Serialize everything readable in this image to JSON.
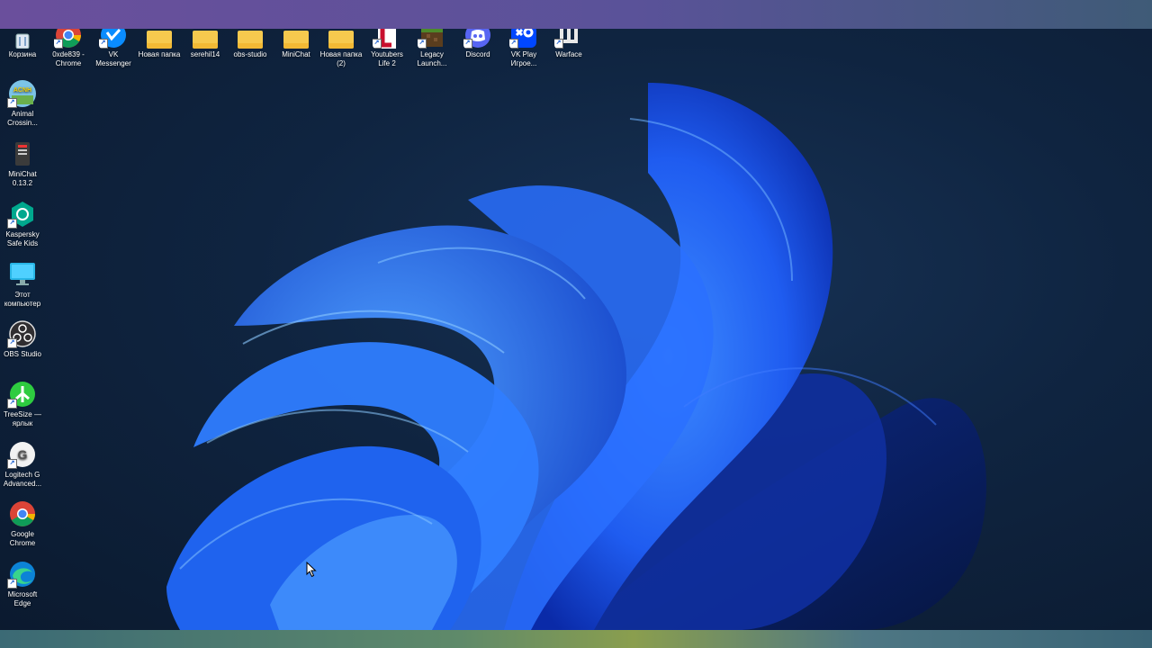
{
  "desktop": {
    "top_icons": [
      {
        "label": "Корзина",
        "icon": "recycle-bin-icon",
        "shortcut": false
      },
      {
        "label": "0xde839 -\nChrome",
        "icon": "chrome-icon",
        "shortcut": true
      },
      {
        "label": "VK\nMessenger",
        "icon": "vk-messenger-icon",
        "shortcut": true
      },
      {
        "label": "Новая папка",
        "icon": "folder-icon",
        "shortcut": false
      },
      {
        "label": "serehil14",
        "icon": "folder-icon",
        "shortcut": false
      },
      {
        "label": "obs-studio",
        "icon": "folder-icon",
        "shortcut": false
      },
      {
        "label": "MiniChat",
        "icon": "folder-icon",
        "shortcut": false
      },
      {
        "label": "Новая папка\n(2)",
        "icon": "folder-icon",
        "shortcut": false
      },
      {
        "label": "Youtubers\nLife 2",
        "icon": "youtubers-life-icon",
        "shortcut": true
      },
      {
        "label": "Legacy\nLaunch...",
        "icon": "legacy-launcher-icon",
        "shortcut": true
      },
      {
        "label": "Discord",
        "icon": "discord-icon",
        "shortcut": true
      },
      {
        "label": "VK Play\nИгрое...",
        "icon": "vk-play-icon",
        "shortcut": true
      },
      {
        "label": "Warface",
        "icon": "warface-icon",
        "shortcut": true
      }
    ],
    "left_icons": [
      {
        "label": "Animal\nCrossin...",
        "icon": "animal-crossing-icon",
        "shortcut": true
      },
      {
        "label": "MiniChat\n0.13.2",
        "icon": "minichat-app-icon",
        "shortcut": false
      },
      {
        "label": "Kaspersky\nSafe Kids",
        "icon": "kaspersky-icon",
        "shortcut": true
      },
      {
        "label": "Этот\nкомпьютер",
        "icon": "this-pc-icon",
        "shortcut": false
      },
      {
        "label": "OBS Studio",
        "icon": "obs-icon",
        "shortcut": true
      },
      {
        "label": "TreeSize —\nярлык",
        "icon": "treesize-icon",
        "shortcut": true
      },
      {
        "label": "Logitech G\nAdvanced...",
        "icon": "logitech-icon",
        "shortcut": true
      },
      {
        "label": "Google\nChrome",
        "icon": "chrome-icon",
        "shortcut": false
      },
      {
        "label": "Microsoft\nEdge",
        "icon": "edge-icon",
        "shortcut": true
      }
    ]
  },
  "colors": {
    "wallpaper_bg": "#0b1a2f",
    "bloom_blue": "#1f5cf0",
    "folder_yellow": "#f6c94e"
  }
}
